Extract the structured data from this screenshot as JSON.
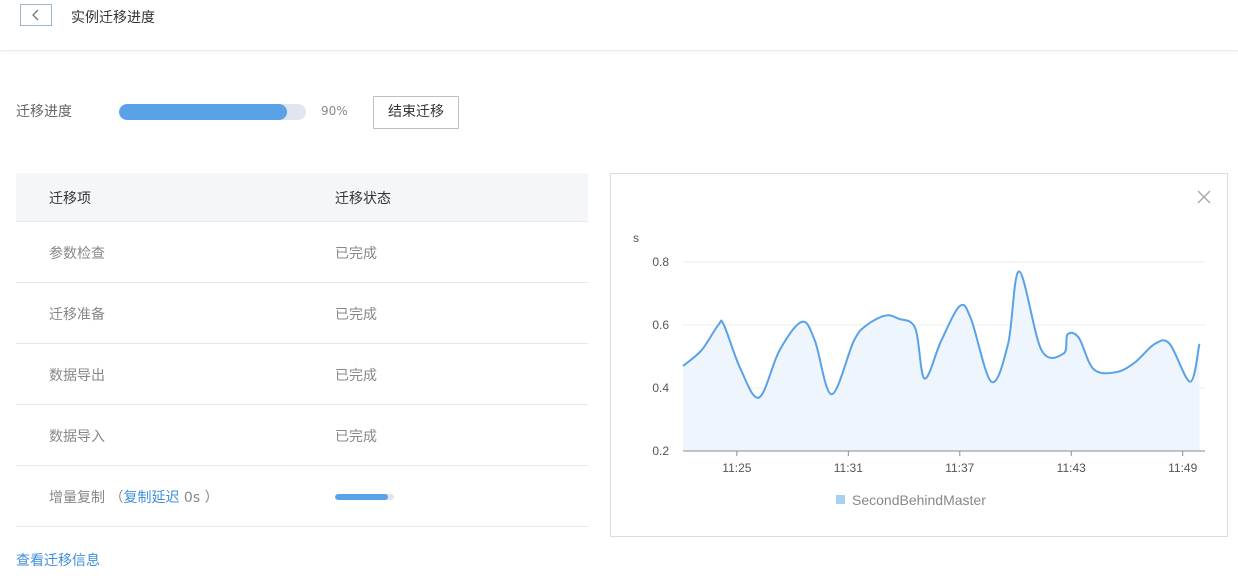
{
  "header": {
    "title": "实例迁移进度",
    "back_icon": "chevron-left-icon"
  },
  "progress": {
    "label": "迁移进度",
    "percent": 90,
    "percent_text": "90%",
    "end_button": "结束迁移"
  },
  "table": {
    "columns": [
      "迁移项",
      "迁移状态"
    ],
    "rows": [
      {
        "item": "参数检查",
        "status": "已完成"
      },
      {
        "item": "迁移准备",
        "status": "已完成"
      },
      {
        "item": "数据导出",
        "status": "已完成"
      },
      {
        "item": "数据导入",
        "status": "已完成"
      }
    ],
    "incremental": {
      "item": "增量复制",
      "paren_open": "（",
      "delay_link": "复制延迟",
      "delay_value": "0s",
      "paren_close": "）",
      "progress_fraction": 0.9
    }
  },
  "view_info_link": "查看迁移信息",
  "chart_data": {
    "type": "area",
    "ylabel": "s",
    "ylim": [
      0.2,
      0.8
    ],
    "yticks": [
      0.2,
      0.4,
      0.6,
      0.8
    ],
    "xticks": [
      "11:25",
      "11:31",
      "11:37",
      "11:43",
      "11:49"
    ],
    "xtick_minutes": [
      25,
      31,
      37,
      43,
      49
    ],
    "xlim_minutes": [
      22.1,
      50.2
    ],
    "series": [
      {
        "name": "SecondBehindMaster",
        "color": "#5aa2e8",
        "x_minutes": [
          22.1,
          23.1,
          24.0,
          24.3,
          25.2,
          26.2,
          27.3,
          28.5,
          29.2,
          30.1,
          31.3,
          32.0,
          33.0,
          33.7,
          34.6,
          35.1,
          36.0,
          37.0,
          37.6,
          38.7,
          39.6,
          40.2,
          41.4,
          42.6,
          42.8,
          43.4,
          44.2,
          45.4,
          46.4,
          47.5,
          48.3,
          49.4,
          49.9
        ],
        "values": [
          0.47,
          0.52,
          0.6,
          0.6,
          0.46,
          0.37,
          0.52,
          0.61,
          0.55,
          0.38,
          0.55,
          0.6,
          0.63,
          0.62,
          0.59,
          0.43,
          0.55,
          0.66,
          0.62,
          0.42,
          0.54,
          0.77,
          0.52,
          0.51,
          0.57,
          0.56,
          0.46,
          0.45,
          0.48,
          0.54,
          0.54,
          0.42,
          0.54
        ]
      }
    ],
    "grid": "horizontal",
    "legend": "bottom"
  },
  "colors": {
    "accent": "#5aa2e8",
    "link": "#3d8fdb"
  }
}
